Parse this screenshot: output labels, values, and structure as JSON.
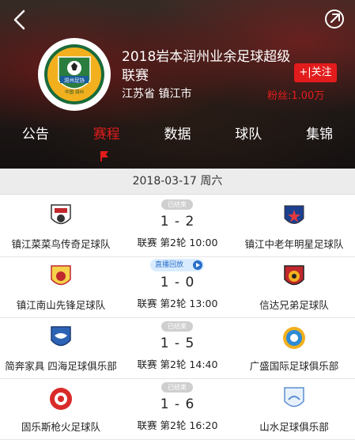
{
  "header": {
    "team_name": "2018岩本润州业余足球超级联赛",
    "location": "江苏省 镇江市",
    "follow_label": "+|关注",
    "fans_label": "粉丝:1.00万",
    "logo_text": "润州足协",
    "logo_subtext": "中国 润州"
  },
  "tabs": [
    {
      "label": "公告"
    },
    {
      "label": "赛程"
    },
    {
      "label": "数据"
    },
    {
      "label": "球队"
    },
    {
      "label": "集锦"
    }
  ],
  "date": "2018-03-17 周六",
  "matches": [
    {
      "status": "已结束",
      "home": "镇江菜菜鸟传奇足球队",
      "away": "镇江中老年明星足球队",
      "score": "1 - 2",
      "info": "联赛 第2轮 10:00"
    },
    {
      "status": "直播回放",
      "home": "镇江南山先锋足球队",
      "away": "信达兄弟足球队",
      "score": "1 - 0",
      "info": "联赛 第2轮 13:00"
    },
    {
      "status": "已结束",
      "home": "简奔家具 四海足球俱乐部",
      "away": "广盛国际足球俱乐部",
      "score": "1 - 5",
      "info": "联赛 第2轮 14:40"
    },
    {
      "status": "已结束",
      "home": "固乐斯枪火足球队",
      "away": "山水足球俱乐部",
      "score": "1 - 6",
      "info": "联赛 第2轮 16:20"
    }
  ],
  "colors": {
    "accent": "#e21c1c",
    "replay": "#2a6fc9"
  }
}
